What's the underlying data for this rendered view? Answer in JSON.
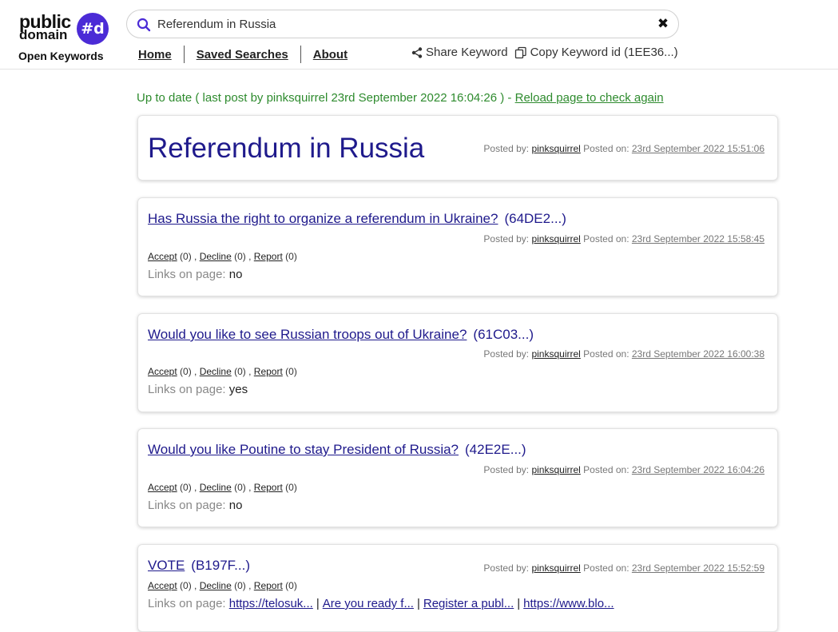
{
  "logo": {
    "line1": "public",
    "line2": "domain",
    "badge": "#d",
    "subtitle": "Open Keywords"
  },
  "search": {
    "value": "Referendum in Russia",
    "clear_symbol": "✖"
  },
  "nav": {
    "home": "Home",
    "saved": "Saved Searches",
    "about": "About"
  },
  "actions": {
    "share": "Share Keyword",
    "copy": "Copy Keyword id (1EE36...)"
  },
  "status": {
    "text": "Up to date ( last post by pinksquirrel 23rd September 2022 16:04:26 ) - ",
    "reload": "Reload page to check again"
  },
  "labels": {
    "posted_by": "Posted by:",
    "posted_on": "Posted on:",
    "accept": "Accept",
    "decline": "Decline",
    "report": "Report",
    "links_on_page": "Links on page:"
  },
  "keyword": {
    "title": "Referendum in Russia",
    "author": "pinksquirrel",
    "date": "23rd September 2022 15:51:06"
  },
  "posts": [
    {
      "title": "Has Russia the right to organize a referendum in Ukraine?",
      "id": "(64DE2...)",
      "author": "pinksquirrel",
      "date": "23rd September 2022 15:58:45",
      "accept": "(0)",
      "decline": "(0)",
      "report": "(0)",
      "links_value": "no"
    },
    {
      "title": "Would you like to see Russian troops out of Ukraine?",
      "id": "(61C03...)",
      "author": "pinksquirrel",
      "date": "23rd September 2022 16:00:38",
      "accept": "(0)",
      "decline": "(0)",
      "report": "(0)",
      "links_value": "yes"
    },
    {
      "title": "Would you like Poutine to stay President of Russia?",
      "id": "(42E2E...)",
      "author": "pinksquirrel",
      "date": "23rd September 2022 16:04:26",
      "accept": "(0)",
      "decline": "(0)",
      "report": "(0)",
      "links_value": "no"
    },
    {
      "title": "VOTE",
      "id": "(B197F...)",
      "author": "pinksquirrel",
      "date": "23rd September 2022 15:52:59",
      "accept": "(0)",
      "decline": "(0)",
      "report": "(0)",
      "links": [
        "https://telosuk...",
        "Are you ready f...",
        "Register a publ...",
        "https://www.blo..."
      ]
    }
  ],
  "colors": {
    "brand": "#4b2bd6",
    "title": "#1f1a8c",
    "status": "#2e8b2e"
  }
}
